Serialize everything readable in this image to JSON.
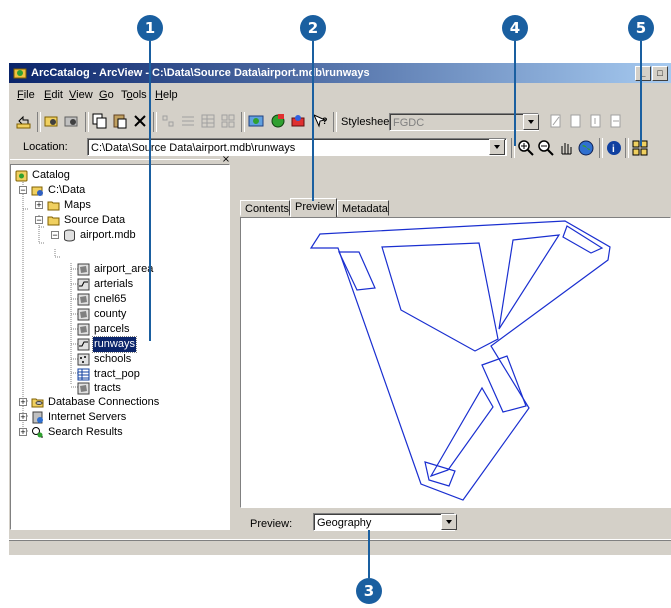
{
  "callouts": [
    "1",
    "2",
    "3",
    "4",
    "5"
  ],
  "window": {
    "title": "ArcCatalog - ArcView - C:\\Data\\Source Data\\airport.mdb\\runways",
    "min_label": "_",
    "max_label": "□"
  },
  "menu": [
    {
      "key": "F",
      "rest": "ile"
    },
    {
      "key": "E",
      "rest": "dit"
    },
    {
      "key": "V",
      "rest": "iew"
    },
    {
      "key": "G",
      "rest": "o"
    },
    {
      "pre": "T",
      "key": "o",
      "rest": "ols"
    },
    {
      "key": "H",
      "rest": "elp"
    }
  ],
  "toolbar": {
    "stylesheet_label": "Stylesheet:",
    "stylesheet_value": "FGDC"
  },
  "location": {
    "label": "Location:",
    "value": "C:\\Data\\Source Data\\airport.mdb\\runways"
  },
  "tree": {
    "catalog": "Catalog",
    "cdata": "C:\\Data",
    "maps": "Maps",
    "source_data": "Source Data",
    "airport_mdb": "airport.mdb",
    "layers": [
      "airport_area",
      "arterials",
      "cnel65",
      "county",
      "parcels",
      "runways",
      "schools",
      "tract_pop",
      "tracts"
    ],
    "database_connections": "Database Connections",
    "internet_servers": "Internet Servers",
    "search_results": "Search Results"
  },
  "tabs": [
    "Contents",
    "Preview",
    "Metadata"
  ],
  "preview": {
    "label": "Preview:",
    "value": "Geography"
  },
  "colors": {
    "callout": "#1a5fa0",
    "title_start": "#0a246a",
    "selection": "#0a246a",
    "runway_line": "#1a2fd0"
  }
}
